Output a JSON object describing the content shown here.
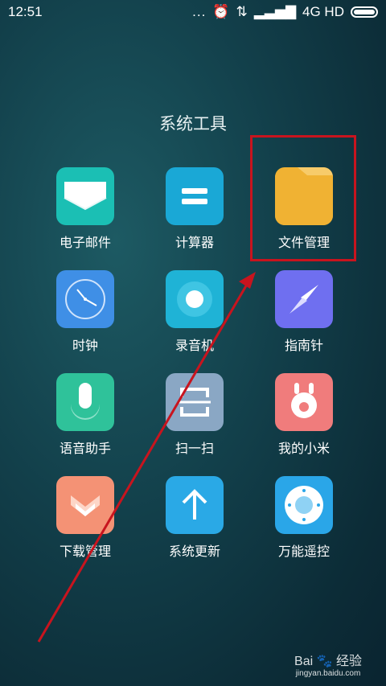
{
  "status": {
    "time": "12:51",
    "dots": "...",
    "network": "4G HD"
  },
  "folder": {
    "title": "系统工具"
  },
  "apps": [
    {
      "label": "电子邮件",
      "color": "#1bbfb4",
      "icon": "mail-icon"
    },
    {
      "label": "计算器",
      "color": "#1aa8d6",
      "icon": "equals-icon"
    },
    {
      "label": "文件管理",
      "color": "#f0b233",
      "icon": "folder-icon"
    },
    {
      "label": "时钟",
      "color": "#3f8fe6",
      "icon": "clock-icon"
    },
    {
      "label": "录音机",
      "color": "#1fb3d6",
      "icon": "record-icon"
    },
    {
      "label": "指南针",
      "color": "#6f6ff0",
      "icon": "compass-icon"
    },
    {
      "label": "语音助手",
      "color": "#2fc29a",
      "icon": "microphone-icon"
    },
    {
      "label": "扫一扫",
      "color": "#8aa7c4",
      "icon": "scan-icon"
    },
    {
      "label": "我的小米",
      "color": "#f07c7c",
      "icon": "mi-bunny-icon"
    },
    {
      "label": "下载管理",
      "color": "#f49275",
      "icon": "download-icon"
    },
    {
      "label": "系统更新",
      "color": "#2aa9e6",
      "icon": "up-arrow-icon"
    },
    {
      "label": "万能遥控",
      "color": "#2aa6e8",
      "icon": "remote-icon"
    }
  ],
  "annotation": {
    "color": "#c8141e"
  },
  "watermark": {
    "brand": "Bai",
    "brand_suffix": "经验",
    "url": "jingyan.baidu.com"
  }
}
